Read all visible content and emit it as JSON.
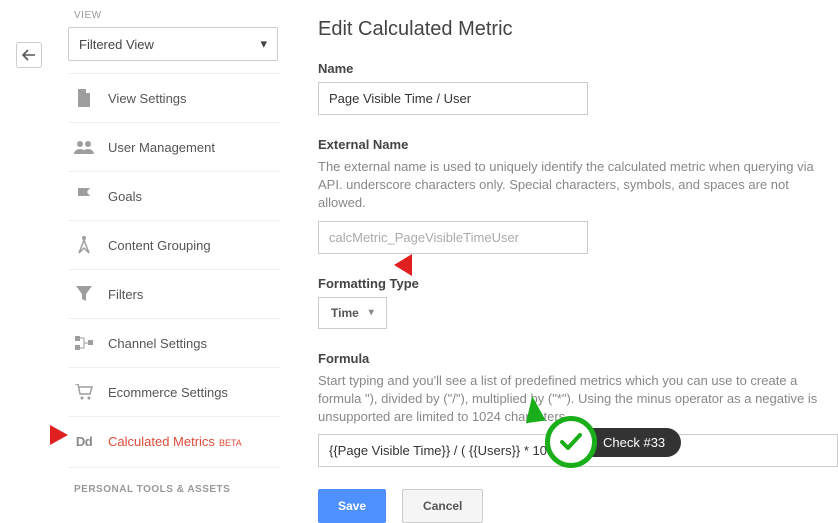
{
  "sidebar": {
    "view_label": "VIEW",
    "view_select": "Filtered View",
    "items": [
      {
        "label": "View Settings"
      },
      {
        "label": "User Management"
      },
      {
        "label": "Goals"
      },
      {
        "label": "Content Grouping"
      },
      {
        "label": "Filters"
      },
      {
        "label": "Channel Settings"
      },
      {
        "label": "Ecommerce Settings"
      },
      {
        "label": "Calculated Metrics",
        "beta": "BETA"
      }
    ],
    "section_label": "PERSONAL TOOLS & ASSETS"
  },
  "main": {
    "title": "Edit Calculated Metric",
    "name_label": "Name",
    "name_value": "Page Visible Time / User",
    "external_label": "External Name",
    "external_help": "The external name is used to uniquely identify the calculated metric when querying via API. underscore characters only. Special characters, symbols, and spaces are not allowed.",
    "external_value": "calcMetric_PageVisibleTimeUser",
    "fmt_label": "Formatting Type",
    "fmt_value": "Time",
    "formula_label": "Formula",
    "formula_help": "Start typing and you'll see a list of predefined metrics which you can use to create a formula \"), divided by (\"/\"), multiplied by (\"*\"). Using the minus operator as a negative is unsupported are limited to 1024 characters.",
    "formula_value": "{{Page Visible Time}} / ( {{Users}} * 1000 )",
    "save": "Save",
    "cancel": "Cancel"
  },
  "badge": {
    "text": "Check #33"
  }
}
